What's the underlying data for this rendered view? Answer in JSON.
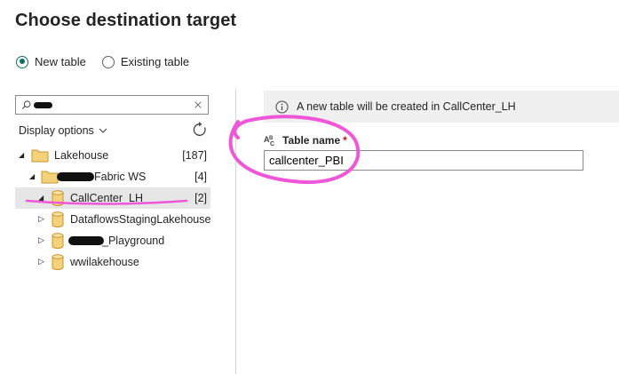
{
  "title": "Choose destination target",
  "radio_options": {
    "new_table": "New table",
    "existing_table": "Existing table",
    "selected": "new_table"
  },
  "search": {
    "value": ""
  },
  "display_options_label": "Display options",
  "tree": {
    "lakehouse": {
      "label": "Lakehouse",
      "count": "[187]"
    },
    "workspace": {
      "label": "Fabric WS",
      "count": "[4]"
    },
    "callcenter": {
      "label": "CallCenter_LH",
      "count": "[2]"
    },
    "dataflows": {
      "label": "DataflowsStagingLakehouse"
    },
    "playground": {
      "label": "_Playground"
    },
    "wwi": {
      "label": "wwilakehouse"
    }
  },
  "info_message": "A new table will be created in CallCenter_LH",
  "table_name": {
    "label": "Table name",
    "required_mark": "*",
    "value": "callcenter_PBI"
  },
  "colors": {
    "accent": "#0f6f5c",
    "folder": "#e8b84a",
    "annotation": "#ee58d8"
  }
}
